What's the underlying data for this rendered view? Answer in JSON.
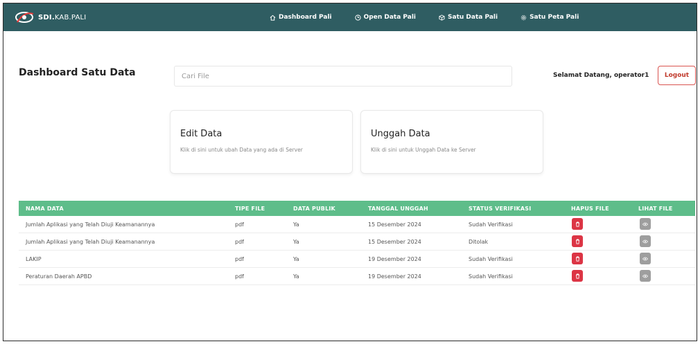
{
  "brand": {
    "bold": "SDI.",
    "light": "KAB.PALI"
  },
  "nav": [
    {
      "label": "Dashboard Pali",
      "icon": "home-icon"
    },
    {
      "label": "Open Data Pali",
      "icon": "clock-icon"
    },
    {
      "label": "Satu Data Pali",
      "icon": "cube-icon"
    },
    {
      "label": "Satu Peta Pali",
      "icon": "gear-icon"
    }
  ],
  "header": {
    "title": "Dashboard Satu Data",
    "search_placeholder": "Cari File",
    "welcome": "Selamat Datang, operator1",
    "logout_label": "Logout"
  },
  "cards": [
    {
      "title": "Edit Data",
      "desc": "Klik di sini untuk ubah Data yang ada di Server"
    },
    {
      "title": "Unggah Data",
      "desc": "Klik di sini untuk Unggah Data ke Server"
    }
  ],
  "table": {
    "columns": [
      "NAMA DATA",
      "TIPE FILE",
      "DATA PUBLIK",
      "TANGGAL UNGGAH",
      "STATUS VERIFIKASI",
      "HAPUS FILE",
      "LIHAT FILE"
    ],
    "rows": [
      {
        "nama": "Jumlah Aplikasi yang Telah Diuji Keamanannya",
        "tipe": "pdf",
        "publik": "Ya",
        "tanggal": "15 Desember 2024",
        "status": "Sudah Verifikasi"
      },
      {
        "nama": "Jumlah Aplikasi yang Telah Diuji Keamanannya",
        "tipe": "pdf",
        "publik": "Ya",
        "tanggal": "15 Desember 2024",
        "status": "Ditolak"
      },
      {
        "nama": "LAKIP",
        "tipe": "pdf",
        "publik": "Ya",
        "tanggal": "19 Desember 2024",
        "status": "Sudah Verifikasi"
      },
      {
        "nama": "Peraturan Daerah APBD",
        "tipe": "pdf",
        "publik": "Ya",
        "tanggal": "19 Desember 2024",
        "status": "Sudah Verifikasi"
      }
    ],
    "delete_icon": "trash-icon",
    "view_icon": "eye-icon"
  },
  "colors": {
    "navbar": "#2f5d62",
    "table_header": "#5ebd8a",
    "delete": "#dc3545",
    "view": "#9e9e9e",
    "logout": "#c0392b"
  }
}
